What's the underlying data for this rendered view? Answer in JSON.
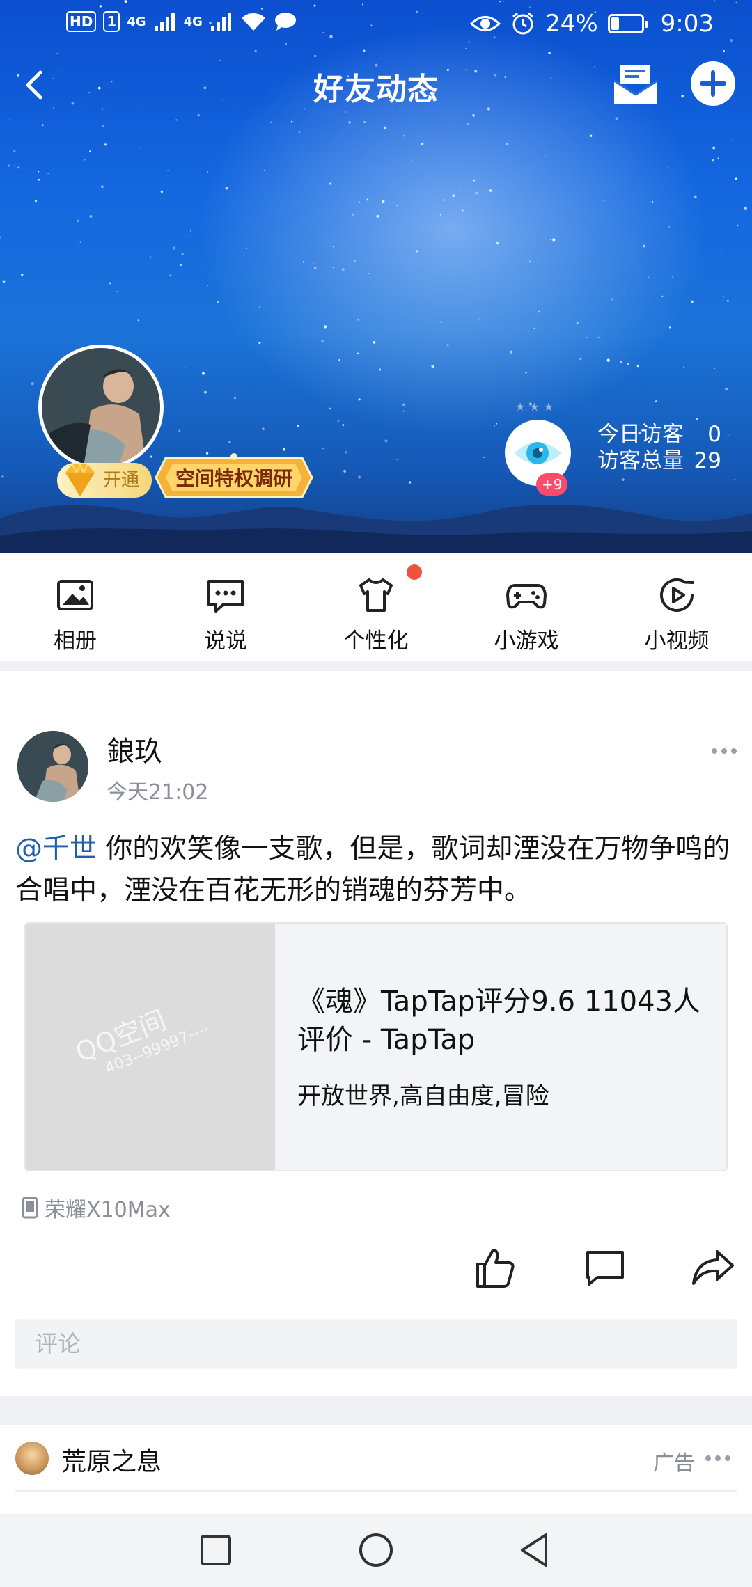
{
  "status_bar": {
    "hd": "HD",
    "sim": "1",
    "net1": "4G",
    "net2": "4G",
    "battery": "24%",
    "time": "9:03"
  },
  "header": {
    "title": "好友动态"
  },
  "profile": {
    "vip_label": "开通",
    "promo_banner": "空间特权调研",
    "visitor_badge": "+9",
    "today_visitors_label": "今日访客",
    "today_visitors_value": "0",
    "total_visitors_label": "访客总量",
    "total_visitors_value": "29"
  },
  "shortcuts": [
    {
      "label": "相册",
      "icon": "photo-album-icon"
    },
    {
      "label": "说说",
      "icon": "chat-bubble-icon"
    },
    {
      "label": "个性化",
      "icon": "tshirt-icon"
    },
    {
      "label": "小游戏",
      "icon": "gamepad-icon"
    },
    {
      "label": "小视频",
      "icon": "play-video-icon"
    }
  ],
  "post": {
    "author": "鋃玖",
    "time": "今天21:02",
    "mention": "@千世",
    "text": " 你的欢笑像一支歌，但是，歌词却湮没在万物争鸣的合唱中，湮没在百花无形的销魂的芬芳中。",
    "card": {
      "thumb_watermark": "QQ空间",
      "thumb_watermark_sub": "403--99997----",
      "title": "《魂》TapTap评分9.6 11043人评价 - TapTap",
      "desc": "开放世界,高自由度,冒险"
    },
    "device": "荣耀X10Max",
    "comment_placeholder": "评论"
  },
  "ad": {
    "name": "荒原之息",
    "tag": "广告"
  },
  "colors": {
    "mention": "#1e5fa8",
    "red_dot": "#f0533d",
    "badge_pink": "#ff4a6a"
  }
}
